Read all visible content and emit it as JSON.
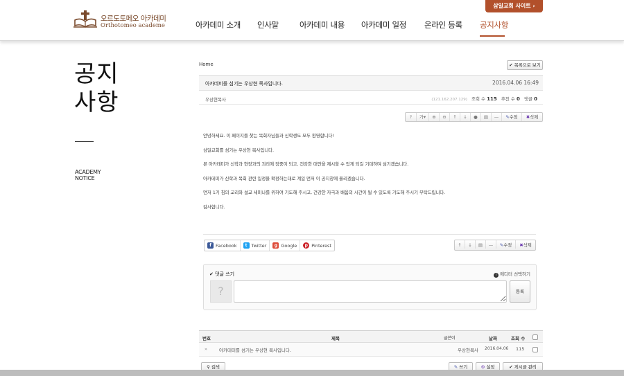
{
  "header": {
    "logo_kr": "오르도토메오 아카데미",
    "logo_en": "Orthotomeo academe",
    "site_button": "삼일교회 사이트",
    "nav": [
      "아카데미 소개",
      "인사말",
      "아카데미 내용",
      "아카데미 일정",
      "온라인 등록",
      "공지사항"
    ],
    "active_nav": "공지사항"
  },
  "sidebar": {
    "title_line1": "공지",
    "title_line2": "사항",
    "sub_line1": "ACADEMY",
    "sub_line2": "NOTICE"
  },
  "breadcrumb": "Home",
  "list_view_button": "목록으로 보기",
  "post": {
    "title": "아카데미를 섬기는 우상현 목사입니다.",
    "date": "2016.04.06 16:49",
    "author": "우상현목사",
    "ip": "(121.162.207.129)",
    "views_label": "조회 수",
    "views": "115",
    "votes_label": "추천 수",
    "votes": "0",
    "comments_label": "댓글",
    "comments": "0",
    "body": [
      "안녕하세요. 이 페이지를 찾는 목회자님들과 신학생도 모두 환영합니다!",
      "삼일교회를 섬기는 우상현 목사입니다.",
      "본 아카데미가 신학과 현장과의 괴리에 징중이 되고, 건강한 대안을 제시할 수 있게 되길 기대하며 섬기겠습니다.",
      "아카데미가 신학과 목회 관련 일정을 확정하는대로 계일 먼저 이 공지창에 올리겠습니다.",
      "먼저 1기 침의 교리와 설교 세미나를 위하여 기도해 주시고, 건강한 자극과 배움의 시간이 될 수 있도록 기도해 주시기 부탁드립니다.",
      "감사합니다."
    ]
  },
  "toolbar": {
    "help": "?",
    "font": "가",
    "edit": "수정",
    "delete": "삭제"
  },
  "share": [
    {
      "label": "Facebook",
      "color": "#3b5998",
      "glyph": "f"
    },
    {
      "label": "Twitter",
      "color": "#1da1f2",
      "glyph": "t"
    },
    {
      "label": "Google",
      "color": "#dd4b39",
      "glyph": "g"
    },
    {
      "label": "Pinterest",
      "color": "#cb2027",
      "glyph": "p"
    }
  ],
  "comment": {
    "title": "댓글 쓰기",
    "editor_select": "에디터 선택하기",
    "submit": "등록",
    "avatar_placeholder": "?"
  },
  "list": {
    "headers": {
      "no": "번호",
      "title": "제목",
      "author": "글쓴이",
      "date": "날짜",
      "views": "조회 수"
    },
    "rows": [
      {
        "no": "»",
        "title": "아카데미를 섬기는 우상현 목사입니다.",
        "author": "우상현목사",
        "date": "2016.04.06",
        "views": "115"
      }
    ]
  },
  "bottom_buttons": {
    "search": "검색",
    "write": "쓰기",
    "settings": "설정",
    "manage": "게시글 관리"
  },
  "colors": {
    "brand": "#b2502b",
    "logo": "#7a4a2c"
  }
}
